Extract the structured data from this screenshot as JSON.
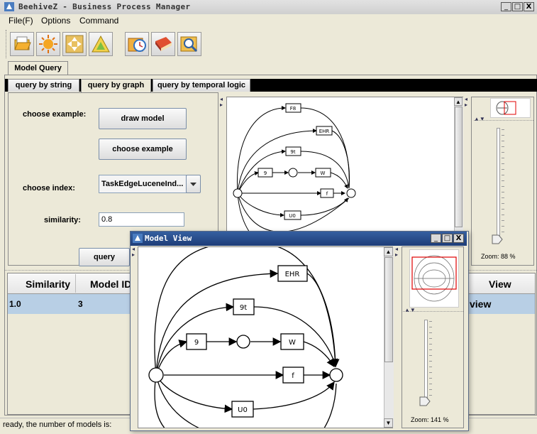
{
  "window": {
    "title": "BeehiveZ - Business Process Manager",
    "minimize": "_",
    "maximize": "□",
    "close": "X"
  },
  "menu": [
    "File(F)",
    "Options",
    "Command"
  ],
  "toolbar_icons": [
    "open-folder-icon",
    "sun-icon",
    "move-icon",
    "triangle-icon",
    "clock-icon",
    "book-icon",
    "magnifier-icon"
  ],
  "main_tab": "Model Query",
  "sub_tabs": [
    "query by string",
    "query by graph",
    "query by temporal logic"
  ],
  "form": {
    "choose_example_label": "choose example:",
    "draw_model_button": "draw model",
    "choose_example_button": "choose example",
    "choose_index_label": "choose index:",
    "index_value": "TaskEdgeLuceneInd...",
    "similarity_label": "similarity:",
    "similarity_value": "0.8",
    "query_button": "query"
  },
  "graph": {
    "nodes": [
      "F8",
      "EHR",
      "9t",
      "9",
      "W",
      "f",
      "U0"
    ]
  },
  "zoom_main": "Zoom: 88 %",
  "table": {
    "columns": [
      "Similarity",
      "Model ID",
      "View"
    ],
    "rows": [
      {
        "similarity": "1.0",
        "model_id": "3",
        "view": "view"
      }
    ]
  },
  "status": "ready, the number of models is: ",
  "model_view": {
    "title": "Model View",
    "minimize": "_",
    "maximize": "□",
    "close": "X",
    "nodes": [
      "EHR",
      "9t",
      "9",
      "W",
      "f",
      "U0"
    ],
    "zoom": "Zoom: 141 %"
  },
  "colors": {
    "accent": "#1e3d78",
    "selected_row": "#b8cfe5",
    "highlight": "#e00000"
  }
}
